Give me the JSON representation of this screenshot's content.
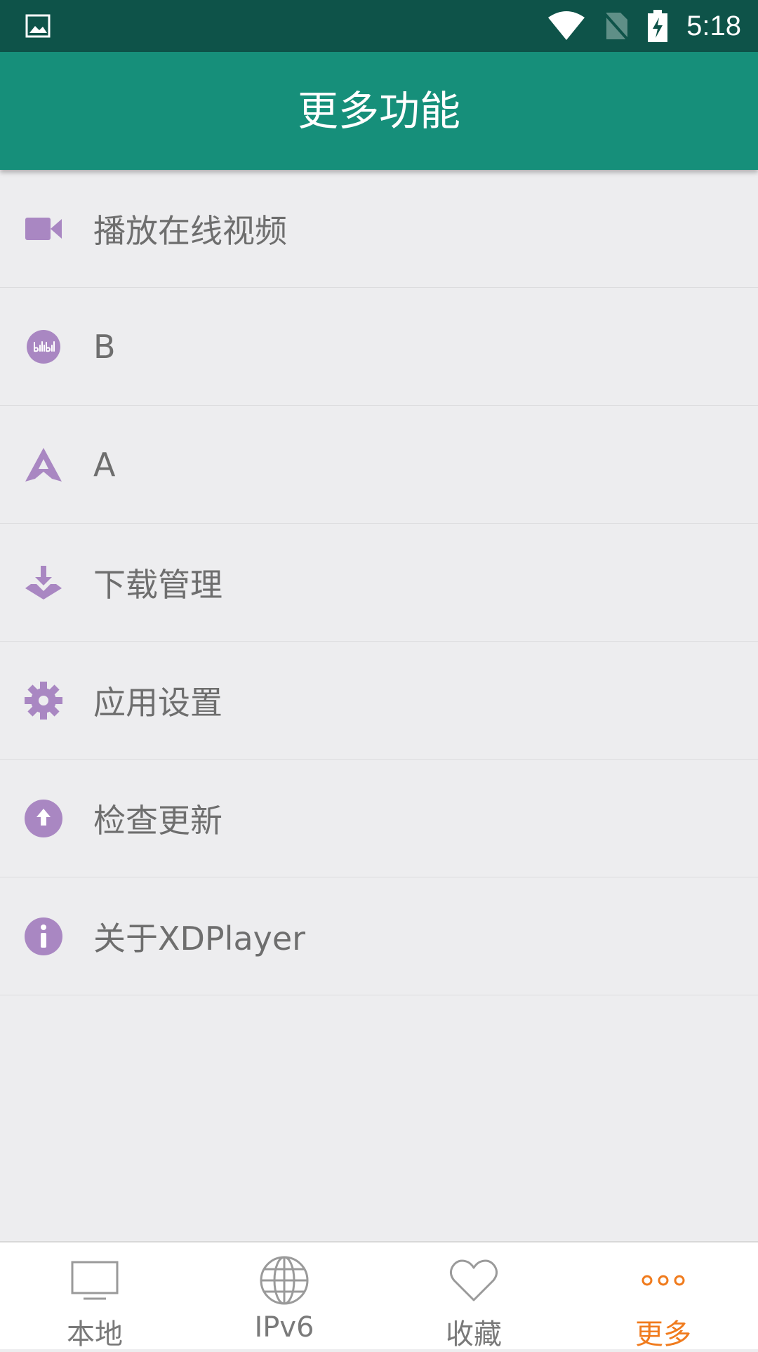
{
  "status_bar": {
    "time": "5:18"
  },
  "app_bar": {
    "title": "更多功能"
  },
  "menu": {
    "items": [
      {
        "label": "播放在线视频",
        "icon": "video-camera-icon"
      },
      {
        "label": "B",
        "icon": "bilibili-icon"
      },
      {
        "label": "A",
        "icon": "acfun-icon"
      },
      {
        "label": "下载管理",
        "icon": "download-tray-icon"
      },
      {
        "label": "应用设置",
        "icon": "gear-icon"
      },
      {
        "label": "检查更新",
        "icon": "upload-circle-icon"
      },
      {
        "label": "关于XDPlayer",
        "icon": "info-icon"
      }
    ]
  },
  "bottom_nav": {
    "items": [
      {
        "label": "本地",
        "icon": "tv-icon",
        "active": false
      },
      {
        "label": "IPv6",
        "icon": "globe-icon",
        "active": false
      },
      {
        "label": "收藏",
        "icon": "heart-icon",
        "active": false
      },
      {
        "label": "更多",
        "icon": "more-dots-icon",
        "active": true
      }
    ]
  },
  "colors": {
    "status_bar": "#0e5349",
    "app_bar": "#168f7a",
    "icon_purple": "#a987c2",
    "active_orange": "#f07b1d",
    "inactive_gray": "#7a7a7a"
  }
}
